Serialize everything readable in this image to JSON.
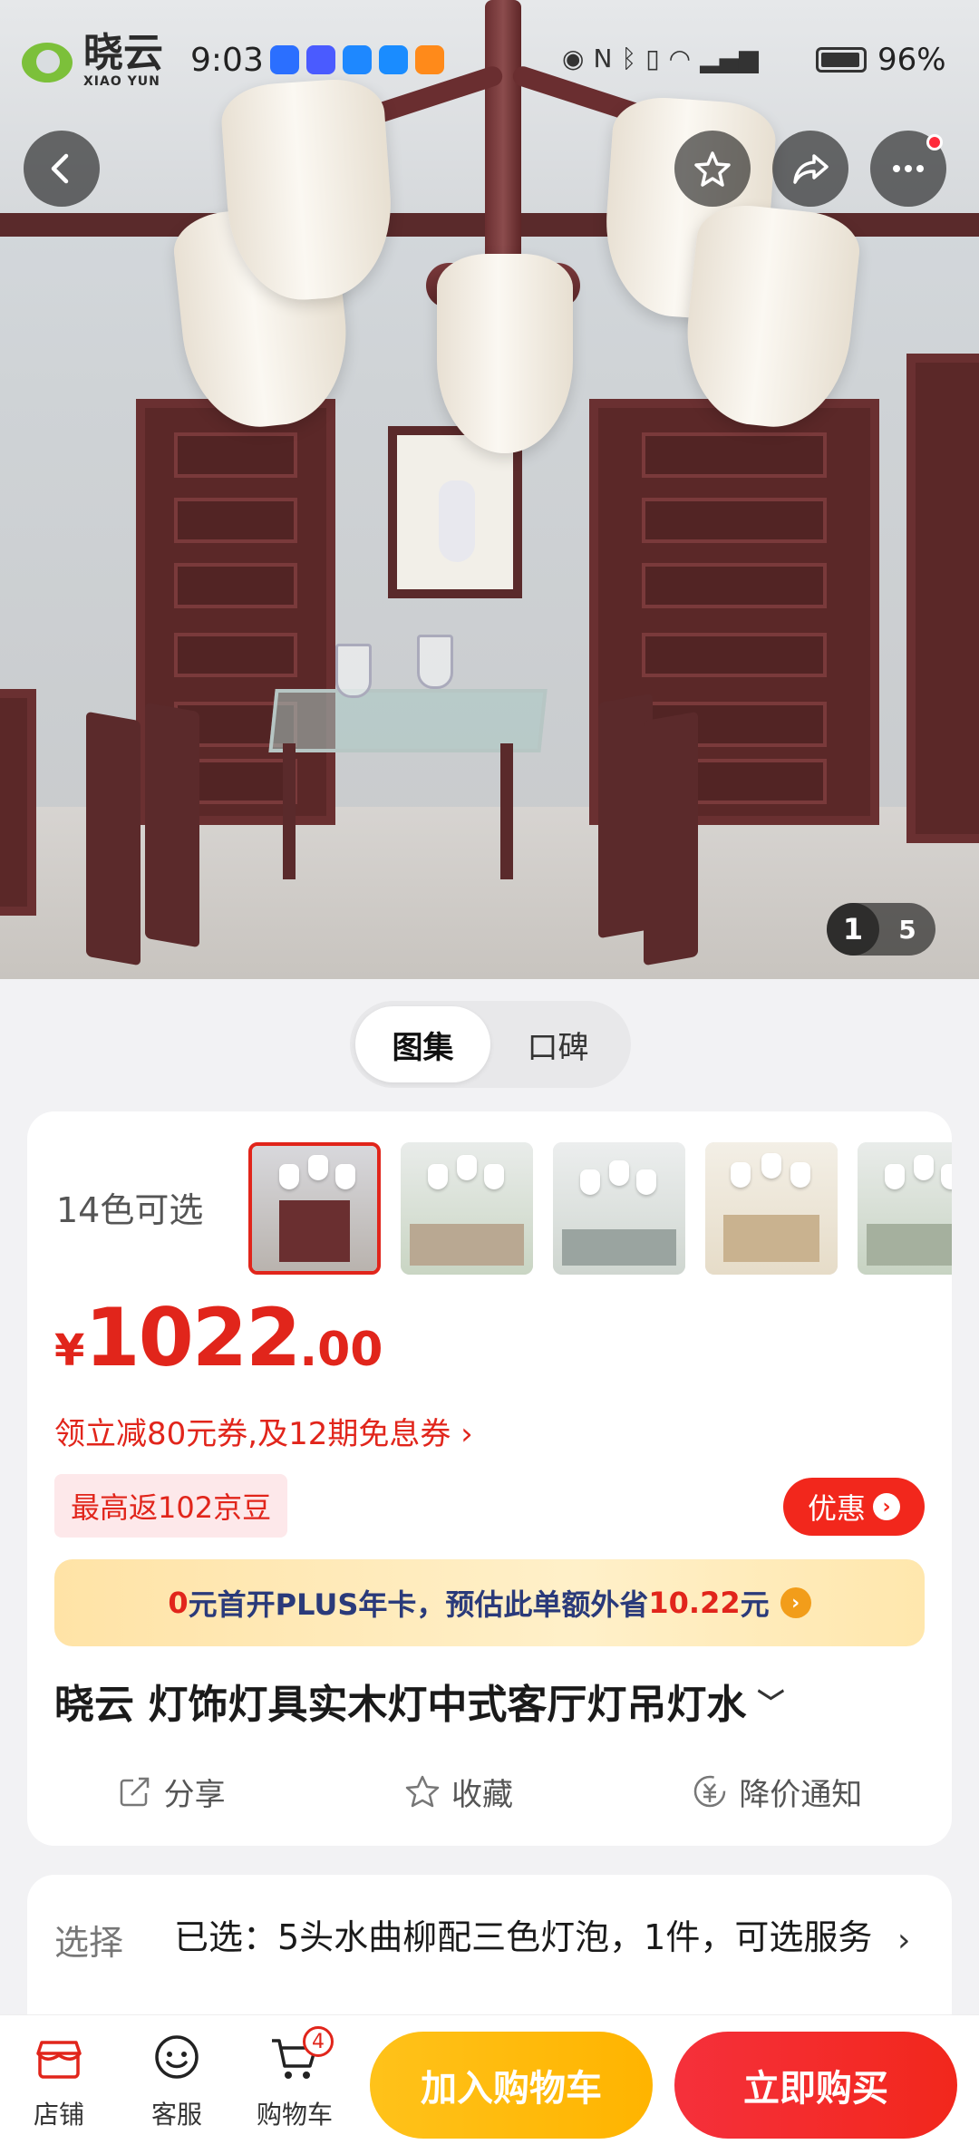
{
  "status_bar": {
    "brand_cn": "晓云",
    "brand_en": "XIAO YUN",
    "time": "9:03",
    "battery": "96%"
  },
  "hero": {
    "current_page": "1",
    "total_pages": "5",
    "alt": "chandelier-room-photo"
  },
  "tabs": [
    {
      "label": "图集",
      "active": true
    },
    {
      "label": "口碑",
      "active": false
    }
  ],
  "product": {
    "colors_label": "14色可选",
    "price_currency": "¥",
    "price_int": "1022",
    "price_dec": ".00",
    "coupon_text": "领立减80元券,及12期免息券 ›",
    "jd_beans": "最高返102京豆",
    "discount_btn": "优惠",
    "plus_prefix": "0",
    "plus_text": "元首开PLUS年卡，预估此单额外省",
    "plus_amount": "10.22",
    "plus_suffix": "元",
    "title": "晓云 灯饰灯具实木灯中式客厅灯吊灯水",
    "actions": [
      {
        "label": "分享",
        "icon": "share-icon"
      },
      {
        "label": "收藏",
        "icon": "star-icon"
      },
      {
        "label": "降价通知",
        "icon": "price-drop-icon"
      }
    ]
  },
  "selection": {
    "label": "选择",
    "text": "已选：5头水曲柳配三色灯泡，1件，可选服务"
  },
  "bottom_nav": {
    "store": "店铺",
    "service": "客服",
    "cart": "购物车",
    "cart_count": "4",
    "add_to_cart": "加入购物车",
    "buy_now": "立即购买"
  },
  "colors": {
    "accent_red": "#e1251b",
    "cta_yellow": "#ffb400",
    "plus_blue": "#2a3a7a"
  }
}
